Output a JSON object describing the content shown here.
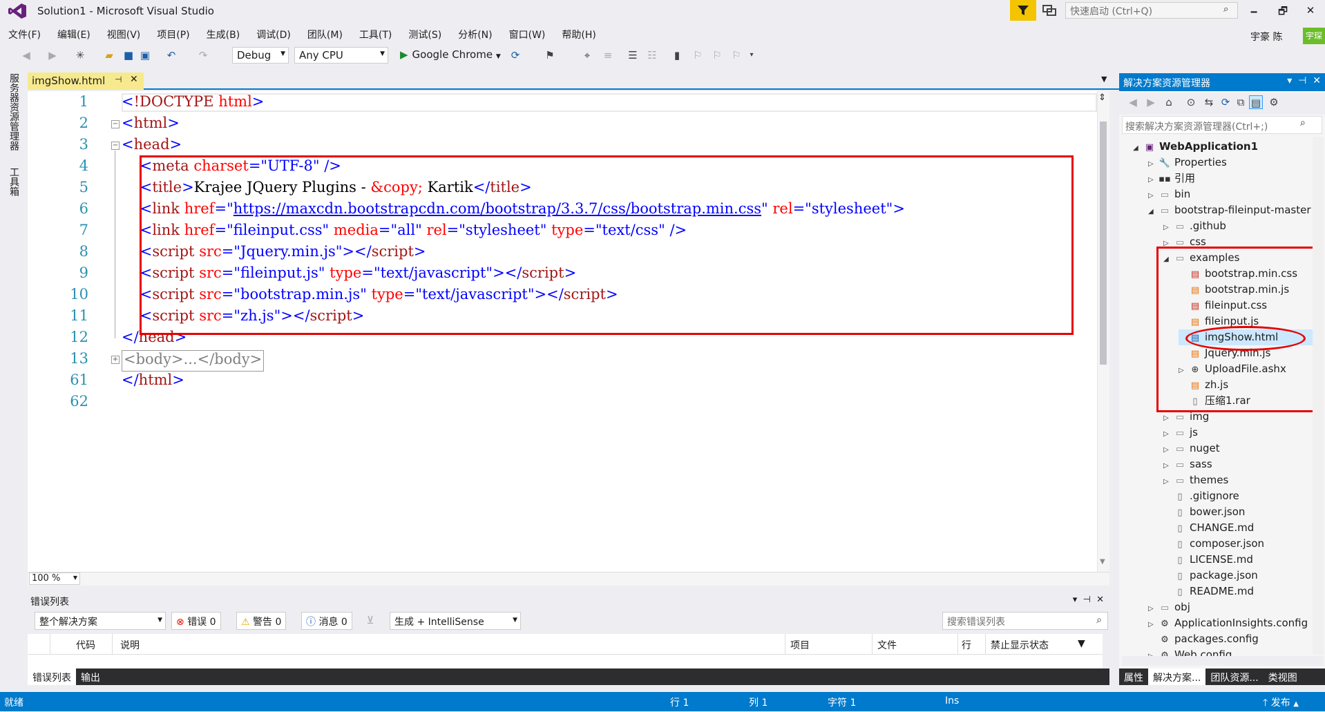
{
  "window": {
    "title": "Solution1 - Microsoft Visual Studio",
    "quick_launch_placeholder": "快速启动 (Ctrl+Q)",
    "user_name": "宇豪 陈",
    "user_badge": "宇琛",
    "minimize": "🗕",
    "maximize": "🗗",
    "close": "✕"
  },
  "menu": [
    "文件(F)",
    "编辑(E)",
    "视图(V)",
    "项目(P)",
    "生成(B)",
    "调试(D)",
    "团队(M)",
    "工具(T)",
    "测试(S)",
    "分析(N)",
    "窗口(W)",
    "帮助(H)"
  ],
  "toolbar": {
    "config": "Debug",
    "platform": "Any CPU",
    "run_target": "Google Chrome"
  },
  "side_tabs": [
    "服务器资源管理器",
    "工具箱"
  ],
  "editor": {
    "tab_name": "imgShow.html",
    "zoom": "100 %",
    "line_numbers": [
      "1",
      "2",
      "3",
      "4",
      "5",
      "6",
      "7",
      "8",
      "9",
      "10",
      "11",
      "12",
      "13",
      "61",
      "62"
    ],
    "collapsed_body": "<body>...</body>"
  },
  "solution_explorer": {
    "title": "解决方案资源管理器",
    "search_placeholder": "搜索解决方案资源管理器(Ctrl+;)",
    "items": [
      {
        "label": "WebApplication1",
        "level": 0,
        "arrow": "◢",
        "icon": "project-icon"
      },
      {
        "label": "Properties",
        "level": 1,
        "arrow": "▷",
        "icon": "wrench-icon"
      },
      {
        "label": "引用",
        "level": 1,
        "arrow": "▷",
        "icon": "references-icon"
      },
      {
        "label": "bin",
        "level": 1,
        "arrow": "▷",
        "icon": "folder-icon"
      },
      {
        "label": "bootstrap-fileinput-master",
        "level": 1,
        "arrow": "◢",
        "icon": "folder-icon"
      },
      {
        "label": ".github",
        "level": 2,
        "arrow": "▷",
        "icon": "folder-icon"
      },
      {
        "label": "css",
        "level": 2,
        "arrow": "▷",
        "icon": "folder-icon"
      },
      {
        "label": "examples",
        "level": 2,
        "arrow": "◢",
        "icon": "folder-icon"
      },
      {
        "label": "bootstrap.min.css",
        "level": 3,
        "arrow": "",
        "icon": "css-file-icon"
      },
      {
        "label": "bootstrap.min.js",
        "level": 3,
        "arrow": "",
        "icon": "js-file-icon"
      },
      {
        "label": "fileinput.css",
        "level": 3,
        "arrow": "",
        "icon": "css-file-icon"
      },
      {
        "label": "fileinput.js",
        "level": 3,
        "arrow": "",
        "icon": "js-file-icon"
      },
      {
        "label": "imgShow.html",
        "level": 3,
        "arrow": "",
        "icon": "html-file-icon"
      },
      {
        "label": "Jquery.min.js",
        "level": 3,
        "arrow": "",
        "icon": "js-file-icon"
      },
      {
        "label": "UploadFile.ashx",
        "level": 3,
        "arrow": "▷",
        "icon": "handler-file-icon"
      },
      {
        "label": "zh.js",
        "level": 3,
        "arrow": "",
        "icon": "js-file-icon"
      },
      {
        "label": "压缩1.rar",
        "level": 3,
        "arrow": "",
        "icon": "file-icon"
      },
      {
        "label": "img",
        "level": 2,
        "arrow": "▷",
        "icon": "folder-icon"
      },
      {
        "label": "js",
        "level": 2,
        "arrow": "▷",
        "icon": "folder-icon"
      },
      {
        "label": "nuget",
        "level": 2,
        "arrow": "▷",
        "icon": "folder-icon"
      },
      {
        "label": "sass",
        "level": 2,
        "arrow": "▷",
        "icon": "folder-icon"
      },
      {
        "label": "themes",
        "level": 2,
        "arrow": "▷",
        "icon": "folder-icon"
      },
      {
        "label": ".gitignore",
        "level": 2,
        "arrow": "",
        "icon": "file-icon"
      },
      {
        "label": "bower.json",
        "level": 2,
        "arrow": "",
        "icon": "file-icon"
      },
      {
        "label": "CHANGE.md",
        "level": 2,
        "arrow": "",
        "icon": "file-icon"
      },
      {
        "label": "composer.json",
        "level": 2,
        "arrow": "",
        "icon": "file-icon"
      },
      {
        "label": "LICENSE.md",
        "level": 2,
        "arrow": "",
        "icon": "file-icon"
      },
      {
        "label": "package.json",
        "level": 2,
        "arrow": "",
        "icon": "file-icon"
      },
      {
        "label": "README.md",
        "level": 2,
        "arrow": "",
        "icon": "file-icon"
      },
      {
        "label": "obj",
        "level": 1,
        "arrow": "▷",
        "icon": "folder-icon"
      },
      {
        "label": "ApplicationInsights.config",
        "level": 1,
        "arrow": "▷",
        "icon": "config-file-icon"
      },
      {
        "label": "packages.config",
        "level": 1,
        "arrow": "",
        "icon": "config-file-icon"
      },
      {
        "label": "Web.config",
        "level": 1,
        "arrow": "▷",
        "icon": "config-file-icon"
      }
    ],
    "bottom_tabs": [
      "属性",
      "解决方案...",
      "团队资源...",
      "类视图"
    ]
  },
  "error_list": {
    "title": "错误列表",
    "scope": "整个解决方案",
    "errors": "错误 0",
    "warnings": "警告 0",
    "messages": "消息 0",
    "build_filter": "生成 + IntelliSense",
    "search_placeholder": "搜索错误列表",
    "columns": [
      "代码",
      "说明",
      "项目",
      "文件",
      "行",
      "禁止显示状态"
    ],
    "bottom_tabs": [
      "错误列表",
      "输出"
    ]
  },
  "status_bar": {
    "ready": "就绪",
    "line": "行 1",
    "col": "列 1",
    "char": "字符 1",
    "ins": "Ins",
    "publish": "发布"
  }
}
